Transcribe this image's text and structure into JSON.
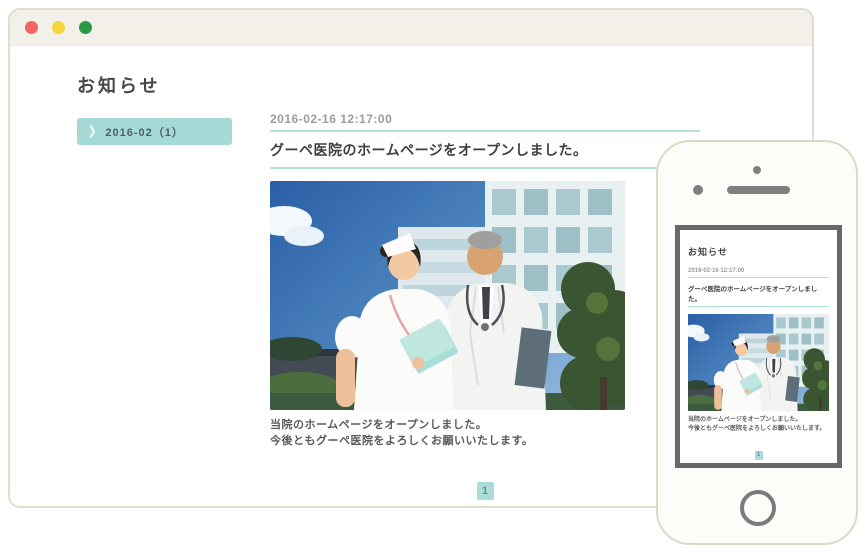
{
  "colors": {
    "accent_teal": "#a5d9d6",
    "underline_teal": "#b3dfdc",
    "pagination_teal": "#a9dcda",
    "titlebar_beige": "#f2f0e9",
    "window_border": "#e2ddcb",
    "traffic_red": "#f2665f",
    "traffic_yellow": "#f6d33c",
    "traffic_green": "#2b9a43",
    "phone_frame_gray": "#686868"
  },
  "browser": {
    "page_title": "お知らせ",
    "sidebar": {
      "chevron": "❯",
      "archive_label": "2016-02（1）"
    },
    "article": {
      "date": "2016-02-16 12:17:00",
      "title": "グーペ医院のホームページをオープンしました。",
      "photo_alt": "病院の前に立つ看護師と医師",
      "body_lines": [
        "当院のホームページをオープンしました。",
        "今後ともグーペ医院をよろしくお願いいたします。"
      ],
      "pagination_current": "1"
    }
  },
  "phone": {
    "page_title": "お知らせ",
    "date": "2016-02-16 12:17:00",
    "title": "グーペ医院のホームページをオープンしました。",
    "body_lines": [
      "当院のホームページをオープンしました。",
      "今後ともグーペ医院をよろしくお願いいたします。"
    ],
    "pagination_current": "1"
  }
}
